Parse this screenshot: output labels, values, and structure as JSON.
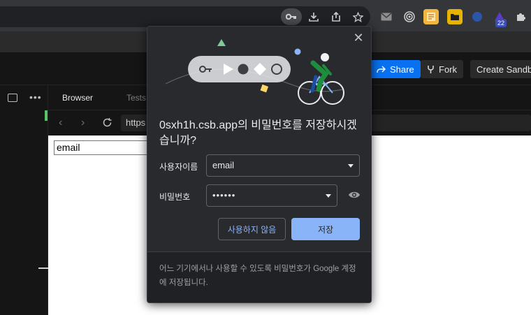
{
  "toolbar": {
    "icons": [
      "key-icon",
      "download-icon",
      "share-page-icon",
      "bookmark-star-icon"
    ],
    "extensions": [
      "mail-extension-icon",
      "target-extension-icon",
      "tabs-extension-icon",
      "folder-extension-icon",
      "firefox-extension-icon",
      "wizard-extension-icon",
      "puzzle-extension-icon"
    ],
    "badge": "22"
  },
  "codesandbox": {
    "share_label": "Share",
    "fork_label": "Fork",
    "create_label": "Create Sandb",
    "tab_browser": "Browser",
    "tab_tests": "Tests",
    "url": "https",
    "email_value": "email"
  },
  "dialog": {
    "title": "0sxh1h.csb.app의 비밀번호를 저장하시겠습니까?",
    "username_label": "사용자이름",
    "username_value": "email",
    "password_label": "비밀번호",
    "password_value": "••••••",
    "decline_label": "사용하지 않음",
    "save_label": "저장",
    "footer_text": "어느 기기에서나 사용할 수 있도록 비밀번호가 Google 계정에 저장됩니다."
  },
  "colors": {
    "accent": "#8ab4f8",
    "dialog_bg": "#292a2d",
    "share": "#0971f1"
  }
}
